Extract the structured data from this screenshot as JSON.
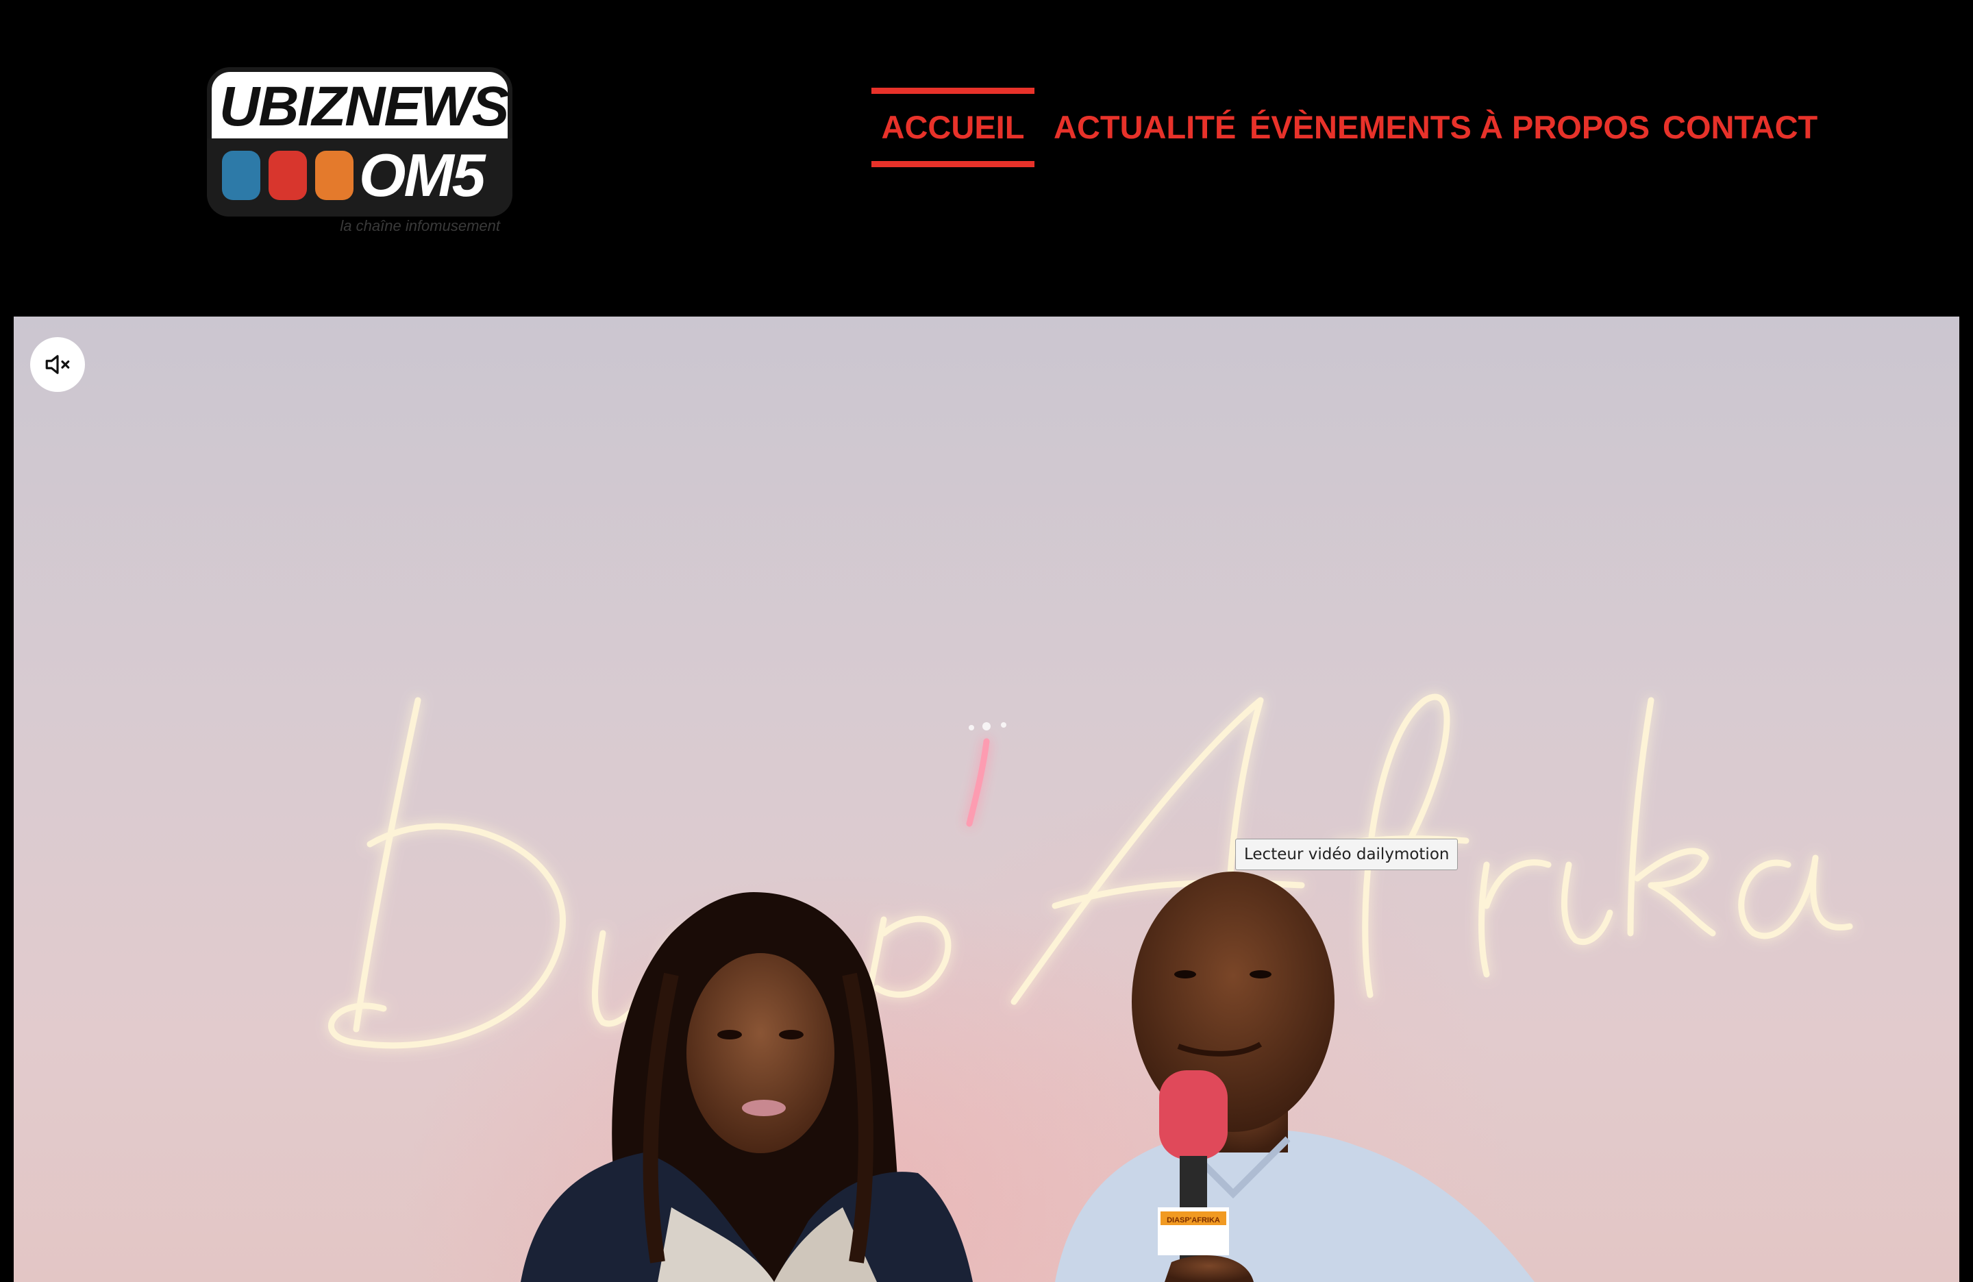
{
  "header": {
    "logo": {
      "line1": "UBIZNEWS",
      "line2": "OM5",
      "tagline": "la chaîne infomusement",
      "chip_colors": [
        "#2d7aa8",
        "#d8362d",
        "#e47a2c"
      ]
    },
    "nav": {
      "active_index": 0,
      "accent_color": "#e8322a",
      "items": [
        {
          "label": "ACCUEIL"
        },
        {
          "label": "ACTUALITÉ"
        },
        {
          "label": "ÉVÈNEMENTS"
        },
        {
          "label": "À PROPOS"
        },
        {
          "label": "CONTACT"
        }
      ]
    }
  },
  "video": {
    "mute_icon": "speaker-muted-icon",
    "tooltip": "Lecteur vidéo dailymotion",
    "neon_sign": "Diasp'Afrika",
    "mic_flag_text": "DIASP'AFRIKA"
  }
}
